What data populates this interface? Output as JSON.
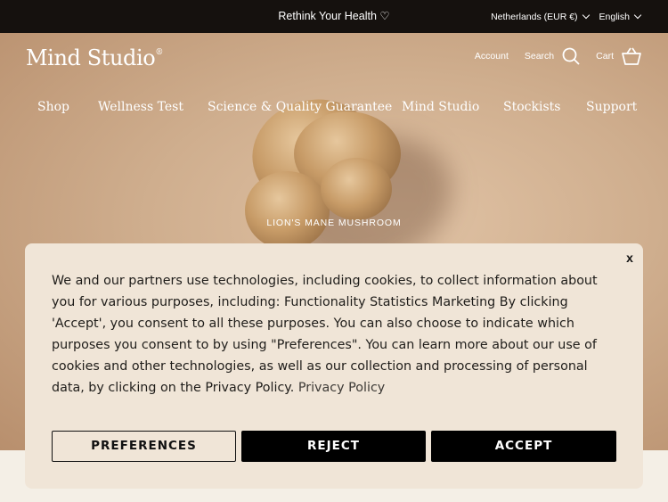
{
  "topbar": {
    "promo": "Rethink Your Health ♡",
    "region": "Netherlands (EUR €)",
    "language": "English"
  },
  "header": {
    "logo": "Mind Studio",
    "logo_mark": "®",
    "account": "Account",
    "search": "Search",
    "cart": "Cart"
  },
  "nav": {
    "items": [
      "Shop",
      "Wellness Test",
      "Science & Quality Guarantee",
      "Mind Studio",
      "Stockists",
      "Support"
    ]
  },
  "hero": {
    "tag": "LION'S MANE MUSHROOM"
  },
  "cookie_banner": {
    "close": "x",
    "text": "We and our partners use technologies, including cookies, to collect information about you for various purposes, including: Functionality Statistics Marketing By clicking 'Accept', you consent to all these purposes. You can also choose to indicate which purposes you consent to by using \"Preferences\". You can learn more about our use of cookies and other technologies, as well as our collection and processing of personal data, by clicking on the Privacy Policy.",
    "link": "Privacy Policy",
    "preferences": "PREFERENCES",
    "reject": "REJECT",
    "accept": "ACCEPT"
  },
  "icons": {
    "search": "search-icon",
    "cart": "basket-icon",
    "chevron": "chevron-down-icon"
  },
  "colors": {
    "topbar_bg": "#15110e",
    "banner_bg": "#f0e5d7",
    "button_bg": "#000000",
    "page_bg": "#f4efe6"
  }
}
